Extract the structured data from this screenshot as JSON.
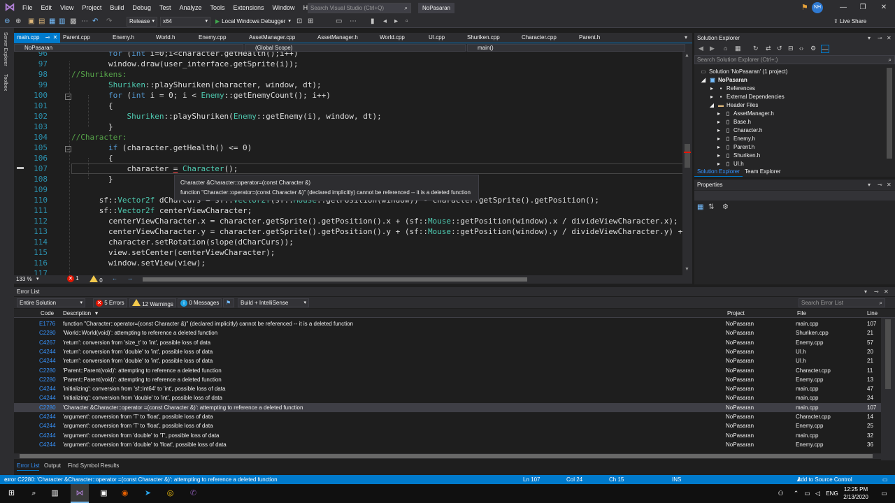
{
  "menu": {
    "items": [
      "File",
      "Edit",
      "View",
      "Project",
      "Build",
      "Debug",
      "Test",
      "Analyze",
      "Tools",
      "Extensions",
      "Window",
      "Help"
    ],
    "search_placeholder": "Search Visual Studio (Ctrl+Q)",
    "project_name": "NoPasaran",
    "user_initials": "NH"
  },
  "toolbar": {
    "config": "Release",
    "platform": "x64",
    "debugger_label": "Local Windows Debugger",
    "live_share": "Live Share"
  },
  "left_strip": {
    "server_explorer": "Server Explorer",
    "toolbox": "Toolbox"
  },
  "doc_tabs": [
    "main.cpp",
    "Parent.cpp",
    "Enemy.h",
    "World.h",
    "Enemy.cpp",
    "AssetManager.cpp",
    "AssetManager.h",
    "World.cpp",
    "UI.cpp",
    "Shuriken.cpp",
    "Character.cpp",
    "Parent.h"
  ],
  "navbar": {
    "project": "NoPasaran",
    "scope": "(Global Scope)",
    "member": "main()"
  },
  "editor": {
    "line_numbers": [
      "96",
      "97",
      "98",
      "99",
      "100",
      "101",
      "102",
      "103",
      "104",
      "105",
      "106",
      "107",
      "108",
      "109",
      "110",
      "111",
      "112",
      "113",
      "114",
      "115",
      "116",
      "117"
    ],
    "tooltip_line1": "Character &Character::operator=(const Character &)",
    "tooltip_line2": "function \"Character::operator=(const Character &)\" (declared implicitly) cannot be referenced -- it is a deleted function",
    "zoom": "133 %",
    "error_count": "1",
    "warning_count": "0"
  },
  "solution_explorer": {
    "title": "Solution Explorer",
    "search_placeholder": "Search Solution Explorer (Ctrl+;)",
    "solution_label": "Solution 'NoPasaran' (1 project)",
    "project": "NoPasaran",
    "references": "References",
    "external_deps": "External Dependencies",
    "header_files": "Header Files",
    "files": [
      "AssetManager.h",
      "Base.h",
      "Character.h",
      "Enemy.h",
      "Parent.h",
      "Shuriken.h",
      "UI.h"
    ],
    "tab_solution": "Solution Explorer",
    "tab_team": "Team Explorer"
  },
  "properties": {
    "title": "Properties"
  },
  "error_list": {
    "title": "Error List",
    "scope": "Entire Solution",
    "errors_btn": "5 Errors",
    "warnings_btn": "12 Warnings",
    "messages_btn": "0 Messages",
    "build_filter": "Build + IntelliSense",
    "search_placeholder": "Search Error List",
    "headers": {
      "code": "Code",
      "description": "Description",
      "project": "Project",
      "file": "File",
      "line": "Line"
    },
    "rows": [
      {
        "type": "intellisense",
        "code": "E1776",
        "desc": "function \"Character::operator=(const Character &)\" (declared implicitly) cannot be referenced -- it is a deleted function",
        "project": "NoPasaran",
        "file": "main.cpp",
        "line": "107"
      },
      {
        "type": "error",
        "code": "C2280",
        "desc": "'World::World(void)': attempting to reference a deleted function",
        "project": "NoPasaran",
        "file": "Shuriken.cpp",
        "line": "21"
      },
      {
        "type": "warning",
        "code": "C4267",
        "desc": "'return': conversion from 'size_t' to 'int', possible loss of data",
        "project": "NoPasaran",
        "file": "Enemy.cpp",
        "line": "57"
      },
      {
        "type": "warning",
        "code": "C4244",
        "desc": "'return': conversion from 'double' to 'int', possible loss of data",
        "project": "NoPasaran",
        "file": "UI.h",
        "line": "20"
      },
      {
        "type": "warning",
        "code": "C4244",
        "desc": "'return': conversion from 'double' to 'int', possible loss of data",
        "project": "NoPasaran",
        "file": "UI.h",
        "line": "21"
      },
      {
        "type": "error",
        "code": "C2280",
        "desc": "'Parent::Parent(void)': attempting to reference a deleted function",
        "project": "NoPasaran",
        "file": "Character.cpp",
        "line": "11"
      },
      {
        "type": "error",
        "code": "C2280",
        "desc": "'Parent::Parent(void)': attempting to reference a deleted function",
        "project": "NoPasaran",
        "file": "Enemy.cpp",
        "line": "13"
      },
      {
        "type": "warning",
        "code": "C4244",
        "desc": "'initializing': conversion from 'sf::Int64' to 'int', possible loss of data",
        "project": "NoPasaran",
        "file": "main.cpp",
        "line": "47"
      },
      {
        "type": "warning",
        "code": "C4244",
        "desc": "'initializing': conversion from 'double' to 'int', possible loss of data",
        "project": "NoPasaran",
        "file": "main.cpp",
        "line": "24"
      },
      {
        "type": "error",
        "code": "C2280",
        "desc": "'Character &Character::operator =(const Character &)': attempting to reference a deleted function",
        "project": "NoPasaran",
        "file": "main.cpp",
        "line": "107",
        "selected": true
      },
      {
        "type": "warning",
        "code": "C4244",
        "desc": "'argument': conversion from 'T' to 'float', possible loss of data",
        "project": "NoPasaran",
        "file": "Character.cpp",
        "line": "14"
      },
      {
        "type": "warning",
        "code": "C4244",
        "desc": "'argument': conversion from 'T' to 'float', possible loss of data",
        "project": "NoPasaran",
        "file": "Enemy.cpp",
        "line": "25"
      },
      {
        "type": "warning",
        "code": "C4244",
        "desc": "'argument': conversion from 'double' to 'T', possible loss of data",
        "project": "NoPasaran",
        "file": "main.cpp",
        "line": "32"
      },
      {
        "type": "warning",
        "code": "C4244",
        "desc": "'argument': conversion from 'double' to 'float', possible loss of data",
        "project": "NoPasaran",
        "file": "Enemy.cpp",
        "line": "36"
      }
    ],
    "tabs": [
      "Error List",
      "Output",
      "Find Symbol Results"
    ]
  },
  "status": {
    "message": "error C2280: 'Character &Character::operator =(const Character &)': attempting to reference a deleted function",
    "ln": "Ln 107",
    "col": "Col 24",
    "ch": "Ch 15",
    "ins": "INS",
    "source_control": "Add to Source Control"
  },
  "taskbar": {
    "lang": "ENG",
    "time": "12:25 PM",
    "date": "2/13/2020"
  },
  "colors": {
    "accent": "#007acc",
    "error": "#e51400",
    "warning": "#f2c94c"
  }
}
